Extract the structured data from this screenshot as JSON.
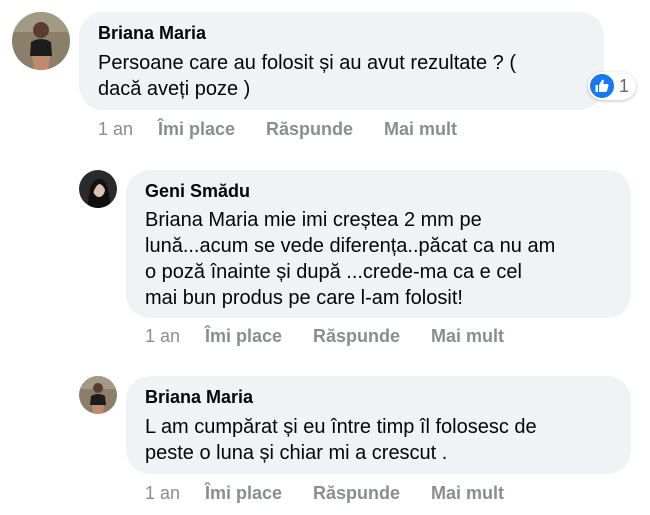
{
  "comments": [
    {
      "author": "Briana Maria",
      "lines": [
        "Persoane care au folosit și au avut rezultate ? (",
        "dacă aveți poze )"
      ],
      "time": "1 an",
      "like": "Îmi place",
      "reply": "Răspunde",
      "more": "Mai mult",
      "reaction_count": "1"
    },
    {
      "author": "Geni Smădu",
      "lines": [
        "Briana Maria mie imi creștea 2 mm pe",
        "lună...acum se vede diferența..păcat ca nu am",
        "o poză înainte și după ...crede-ma ca e cel",
        "mai bun produs pe care l-am folosit!"
      ],
      "time": "1 an",
      "like": "Îmi place",
      "reply": "Răspunde",
      "more": "Mai mult"
    },
    {
      "author": "Briana Maria",
      "lines": [
        "L am cumpărat și eu între timp îl folosesc de",
        "peste o luna și chiar mi a crescut ."
      ],
      "time": "1 an",
      "like": "Îmi place",
      "reply": "Răspunde",
      "more": "Mai mult"
    }
  ],
  "colors": {
    "bubble": "#f0f2f5",
    "meta_text": "#8a8d91",
    "like_blue": "#1877f2"
  }
}
